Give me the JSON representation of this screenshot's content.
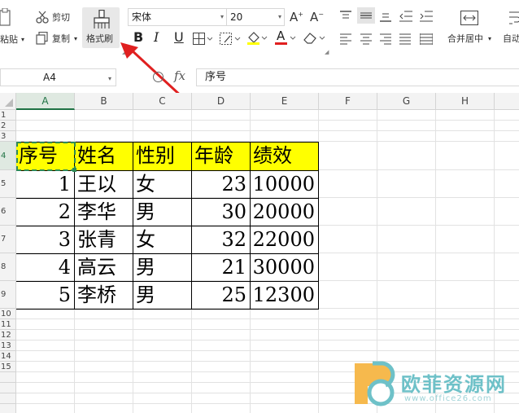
{
  "ribbon": {
    "paste_label": "粘贴",
    "cut_label": "剪切",
    "copy_label": "复制",
    "format_painter_label": "格式刷",
    "font_name": "宋体",
    "font_size": "20",
    "bold": "B",
    "italic": "I",
    "underline": "U",
    "font_color_letter": "A",
    "merge_center_label": "合并居中",
    "auto_wrap_label": "自动",
    "accent_color": "#e02020",
    "highlight_color": "#ffff00"
  },
  "formula_bar": {
    "name_box": "A4",
    "fx_label": "fx",
    "content": "序号"
  },
  "sheet": {
    "columns": [
      "A",
      "B",
      "C",
      "D",
      "E",
      "F",
      "G",
      "H"
    ],
    "rows": [
      "1",
      "2",
      "3",
      "4",
      "5",
      "6",
      "7",
      "8",
      "9",
      "10",
      "11",
      "12",
      "13",
      "14",
      "15"
    ],
    "active_cell": "A4",
    "header_fill": "#ffff00",
    "table": {
      "headers": [
        "序号",
        "姓名",
        "性别",
        "年龄",
        "绩效"
      ],
      "rows": [
        [
          "1",
          "王以",
          "女",
          "23",
          "10000"
        ],
        [
          "2",
          "李华",
          "男",
          "30",
          "20000"
        ],
        [
          "3",
          "张青",
          "女",
          "32",
          "22000"
        ],
        [
          "4",
          "高云",
          "男",
          "21",
          "30000"
        ],
        [
          "5",
          "李桥",
          "男",
          "25",
          "12300"
        ]
      ]
    }
  },
  "watermark": {
    "text": "欧菲资源网",
    "url": "www.office26.com"
  }
}
